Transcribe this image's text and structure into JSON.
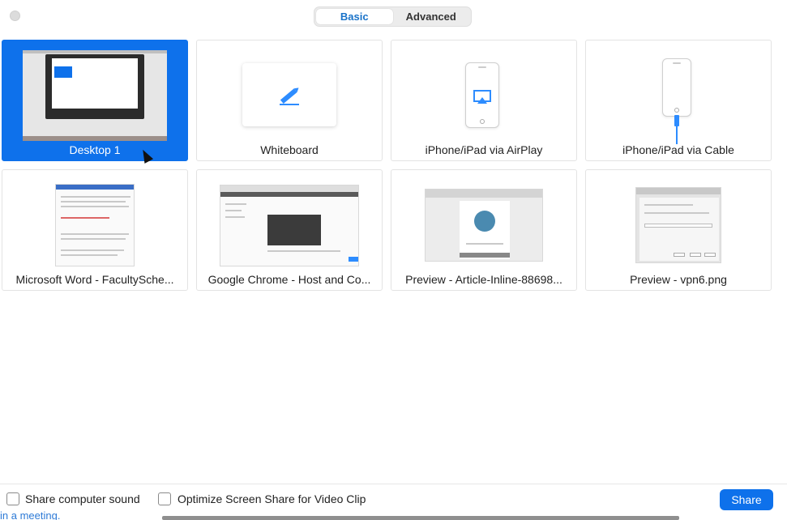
{
  "tabs": [
    {
      "label": "Basic",
      "active": true
    },
    {
      "label": "Advanced",
      "active": false
    }
  ],
  "tiles": [
    {
      "label": "Desktop 1",
      "selected": true
    },
    {
      "label": "Whiteboard",
      "selected": false
    },
    {
      "label": "iPhone/iPad via AirPlay",
      "selected": false
    },
    {
      "label": "iPhone/iPad via Cable",
      "selected": false
    },
    {
      "label": "Microsoft Word - FacultySche...",
      "selected": false
    },
    {
      "label": "Google Chrome - Host and Co...",
      "selected": false
    },
    {
      "label": "Preview - Article-Inline-88698...",
      "selected": false
    },
    {
      "label": "Preview - vpn6.png",
      "selected": false
    }
  ],
  "options": {
    "share_sound": {
      "label": "Share computer sound",
      "checked": false
    },
    "optimize_video": {
      "label": "Optimize Screen Share for Video Clip",
      "checked": false
    }
  },
  "share_button": "Share",
  "background_text": "in a meeting.",
  "colors": {
    "accent": "#0e71eb",
    "selected_tab_text": "#1a73c9"
  },
  "icons": {
    "whiteboard": "pencil-icon",
    "airplay": "airplay-icon",
    "cable": "lightning-cable-icon",
    "cursor": "mouse-pointer-icon"
  }
}
